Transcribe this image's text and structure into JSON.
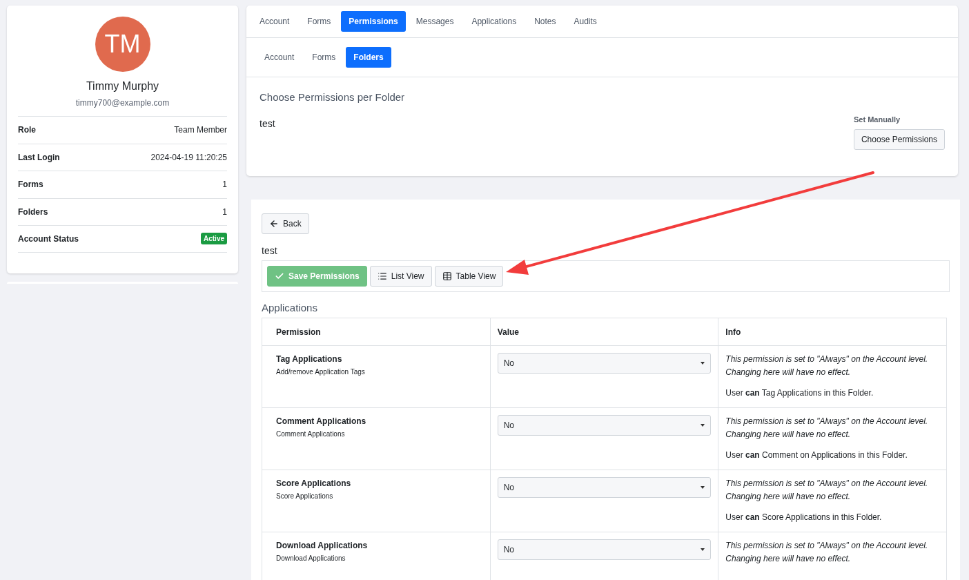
{
  "profile": {
    "initials": "TM",
    "name": "Timmy Murphy",
    "email": "timmy700@example.com",
    "details": [
      {
        "label": "Role",
        "value": "Team Member",
        "kind": "text"
      },
      {
        "label": "Last Login",
        "value": "2024-04-19 11:20:25",
        "kind": "text"
      },
      {
        "label": "Forms",
        "value": "1",
        "kind": "text"
      },
      {
        "label": "Folders",
        "value": "1",
        "kind": "text"
      },
      {
        "label": "Account Status",
        "value": "Active",
        "kind": "badge"
      }
    ]
  },
  "tabs": [
    {
      "label": "Account",
      "selected": false
    },
    {
      "label": "Forms",
      "selected": false
    },
    {
      "label": "Permissions",
      "selected": true
    },
    {
      "label": "Messages",
      "selected": false
    },
    {
      "label": "Applications",
      "selected": false
    },
    {
      "label": "Notes",
      "selected": false
    },
    {
      "label": "Audits",
      "selected": false
    }
  ],
  "subtabs": [
    {
      "label": "Account",
      "selected": false
    },
    {
      "label": "Forms",
      "selected": false
    },
    {
      "label": "Folders",
      "selected": true
    }
  ],
  "folders_card": {
    "heading": "Choose Permissions per Folder",
    "folders": [
      {
        "name": "test",
        "mode_label": "Set Manually",
        "button": "Choose Permissions"
      }
    ]
  },
  "editor": {
    "back": "Back",
    "folder": "test",
    "toolbar": [
      {
        "label": "Save Permissions",
        "kind": "save",
        "disabled": true
      },
      {
        "label": "List View",
        "kind": "list",
        "disabled": false
      },
      {
        "label": "Table View",
        "kind": "table",
        "disabled": false
      }
    ],
    "section": "Applications",
    "columns": [
      "Permission",
      "Value",
      "Info"
    ],
    "rows": [
      {
        "title": "Tag Applications",
        "description": "Add/remove Application Tags",
        "value": "No",
        "note": "This permission is set to \"Always\" on the Account level. Changing here will have no effect.",
        "result": "User **can** Tag Applications in this Folder."
      },
      {
        "title": "Comment Applications",
        "description": "Comment Applications",
        "value": "No",
        "note": "This permission is set to \"Always\" on the Account level. Changing here will have no effect.",
        "result": "User **can** Comment on Applications in this Folder."
      },
      {
        "title": "Score Applications",
        "description": "Score Applications",
        "value": "No",
        "note": "This permission is set to \"Always\" on the Account level. Changing here will have no effect.",
        "result": "User **can** Score Applications in this Folder."
      },
      {
        "title": "Download Applications",
        "description": "Download Applications",
        "value": "No",
        "note": "This permission is set to \"Always\" on the Account level. Changing here will have no effect."
      }
    ]
  }
}
